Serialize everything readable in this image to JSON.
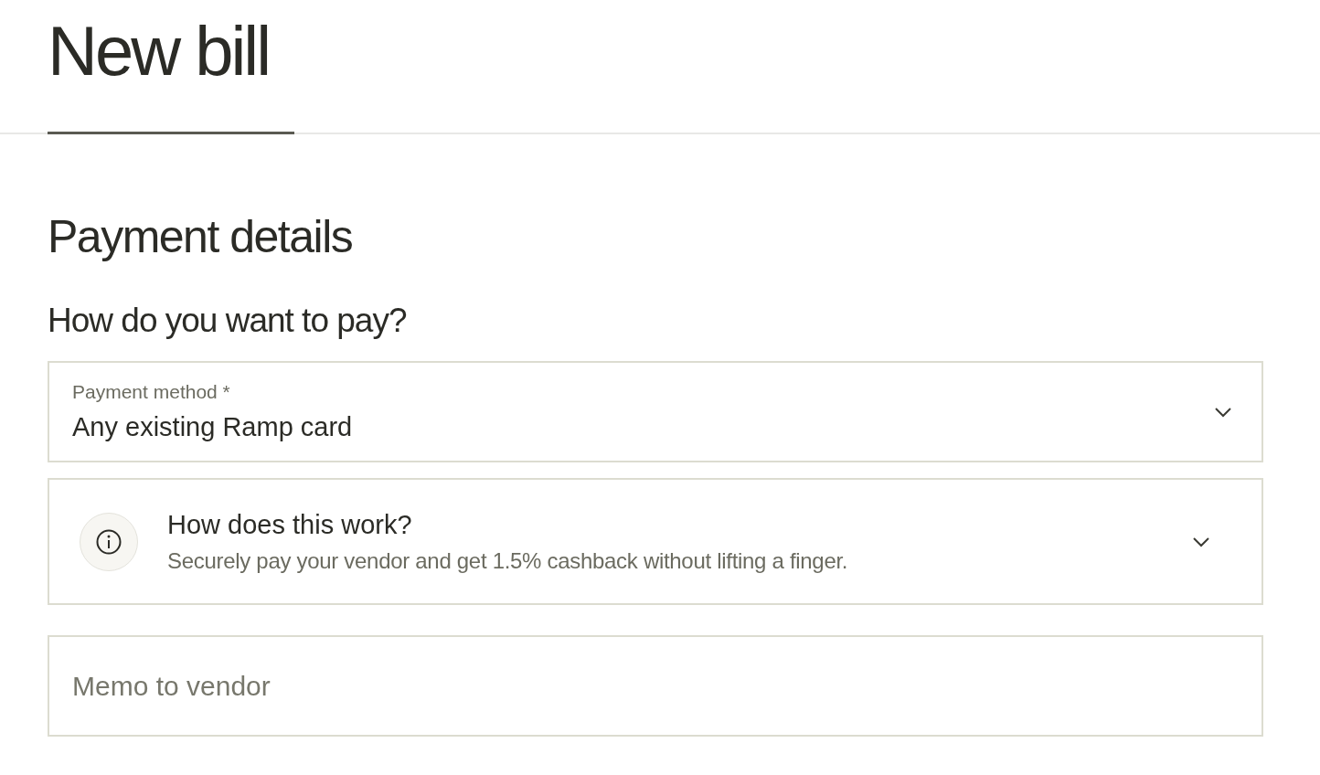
{
  "page": {
    "title": "New bill"
  },
  "section": {
    "title": "Payment details",
    "question": "How do you want to pay?"
  },
  "payment_method": {
    "label": "Payment method *",
    "value": "Any existing Ramp card"
  },
  "info": {
    "title": "How does this work?",
    "description": "Securely pay your vendor and get 1.5% cashback without lifting a finger.",
    "expanded": false
  },
  "memo": {
    "placeholder": "Memo to vendor"
  }
}
